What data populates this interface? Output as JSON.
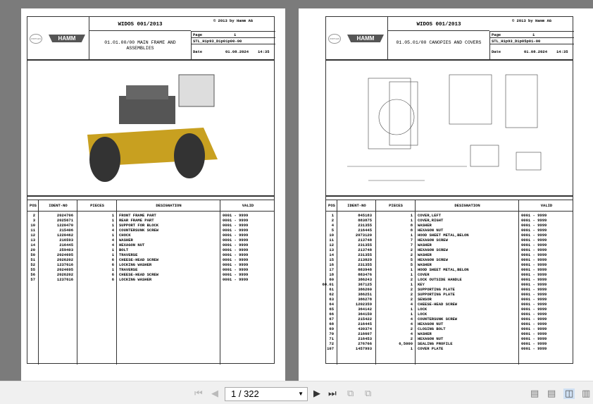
{
  "pages": [
    {
      "title": "WIDOS 001/2013",
      "copyright": "© 2013 by Hamm AG",
      "logo_brand": "HAMM",
      "logo_group": "WIRTGEN GROUP",
      "description": "01.01.00/00 MAIN FRAME AND ASSEMBLIES",
      "page_label": "Page",
      "page_no": "1",
      "doc_id": "STL_H1p93_D1p01p00-00",
      "date_label": "Date",
      "date": "01.08.2024",
      "time": "14:35",
      "figure_callouts": [
        "12",
        "10",
        "11",
        "13",
        "14",
        "11",
        "13",
        "14",
        "56",
        "20",
        "50",
        "51",
        "52",
        "55",
        "56",
        "57",
        "2",
        "3"
      ],
      "headers": {
        "pos": "POS",
        "ident": "IDENT-NO",
        "pieces": "PIECES",
        "designation": "DESIGNATION",
        "valid": "VALID"
      },
      "rows": [
        [
          "2",
          "2024706",
          "1",
          "FRONT FRAME PART",
          "0001 - 9999"
        ],
        [
          "3",
          "2025671",
          "1",
          "REAR FRAME PART",
          "0001 - 9999"
        ],
        [
          "10",
          "1220470",
          "1",
          "SUPPORT FOR BLOCK",
          "0001 - 9999"
        ],
        [
          "11",
          "215406",
          "4",
          "COUNTERSUNK SCREW",
          "0001 - 9999"
        ],
        [
          "12",
          "1220462",
          "1",
          "CHOCK",
          "0001 - 9999"
        ],
        [
          "13",
          "216593",
          "4",
          "WASHER",
          "0001 - 9999"
        ],
        [
          "14",
          "216445",
          "4",
          "HEXAGON NUT",
          "0001 - 9999"
        ],
        [
          "20",
          "259403",
          "1",
          "BOLT",
          "0001 - 9999"
        ],
        [
          "50",
          "2024695",
          "1",
          "TRAVERSE",
          "0001 - 9999"
        ],
        [
          "51",
          "2026202",
          "6",
          "CHEESE-HEAD SCREW",
          "0001 - 9999"
        ],
        [
          "52",
          "1237616",
          "6",
          "LOCKING WASHER",
          "0001 - 9999"
        ],
        [
          "55",
          "2024695",
          "1",
          "TRAVERSE",
          "0001 - 9999"
        ],
        [
          "56",
          "2026202",
          "6",
          "CHEESE-HEAD SCREW",
          "0001 - 9999"
        ],
        [
          "57",
          "1237616",
          "6",
          "LOCKING WASHER",
          "0001 - 9999"
        ]
      ]
    },
    {
      "title": "WIDOS 001/2013",
      "copyright": "© 2013 by Hamm AG",
      "logo_brand": "HAMM",
      "logo_group": "WIRTGEN GROUP",
      "description": "01.05.01/00 CANOPIES AND COVERS",
      "page_label": "Page",
      "page_no": "1",
      "doc_id": "STL_H1p93_D1p05p01-00",
      "date_label": "Date",
      "date": "01.08.2024",
      "time": "14:35",
      "figure_callouts": [
        "ANSICHT X",
        "ANSICHT Y",
        "ANSICHT Z",
        "EINZELHEIT X",
        "SCHNITT G-E",
        "EINZELHEIT Y"
      ],
      "headers": {
        "pos": "POS",
        "ident": "IDENT-NO",
        "pieces": "PIECES",
        "designation": "DESIGNATION",
        "valid": "VALID"
      },
      "rows": [
        [
          "1",
          "845183",
          "1",
          "COVER,LEFT",
          "0001 - 9999"
        ],
        [
          "2",
          "883875",
          "1",
          "COVER,RIGHT",
          "0001 - 9999"
        ],
        [
          "4",
          "231355",
          "8",
          "WASHER",
          "0001 - 9999"
        ],
        [
          "5",
          "216445",
          "8",
          "HEXAGON NUT",
          "0001 - 9999"
        ],
        [
          "10",
          "2073120",
          "1",
          "HOOD SHEET METAL,BELON",
          "0001 - 9999"
        ],
        [
          "11",
          "213748",
          "7",
          "HEXAGON SCREW",
          "0001 - 9999"
        ],
        [
          "12",
          "231355",
          "7",
          "WASHER",
          "0001 - 9999"
        ],
        [
          "13",
          "213748",
          "2",
          "HEXAGON SCREW",
          "0001 - 9999"
        ],
        [
          "14",
          "231355",
          "2",
          "WASHER",
          "0001 - 9999"
        ],
        [
          "15",
          "213829",
          "5",
          "HEXAGON SCREW",
          "0001 - 9999"
        ],
        [
          "16",
          "231355",
          "5",
          "WASHER",
          "0001 - 9999"
        ],
        [
          "17",
          "883948",
          "1",
          "HOOD SHEET METAL,BELON",
          "0001 - 9999"
        ],
        [
          "18",
          "883476",
          "1",
          "COVER",
          "0001 - 9999"
        ],
        [
          "60",
          "386243",
          "2",
          "LOCK OUTSIDE HANDLE",
          "0001 - 9999"
        ],
        [
          "60.01",
          "367125",
          "1",
          "KEY",
          "0001 - 9999"
        ],
        [
          "61",
          "386260",
          "2",
          "SUPPORTING PLATE",
          "0001 - 9999"
        ],
        [
          "62",
          "386251",
          "2",
          "SUPPORTING PLATE",
          "0001 - 9999"
        ],
        [
          "63",
          "386278",
          "2",
          "SENSOR",
          "0001 - 9999"
        ],
        [
          "64",
          "1202359",
          "4",
          "CHEESE-HEAD SCREW",
          "0001 - 9999"
        ],
        [
          "65",
          "364142",
          "1",
          "LOCK",
          "0001 - 9999"
        ],
        [
          "66",
          "364150",
          "1",
          "LOCK",
          "0001 - 9999"
        ],
        [
          "67",
          "215422",
          "4",
          "COUNTERSUNK SCREW",
          "0001 - 9999"
        ],
        [
          "68",
          "216445",
          "4",
          "HEXAGON NUT",
          "0001 - 9999"
        ],
        [
          "69",
          "430374",
          "2",
          "CLOSING BOLT",
          "0001 - 9999"
        ],
        [
          "70",
          "216607",
          "4",
          "WASHER",
          "0001 - 9999"
        ],
        [
          "71",
          "216453",
          "2",
          "HEXAGON NUT",
          "0001 - 9999"
        ],
        [
          "72",
          "276766",
          "6,5000",
          "SEALING PROFILE",
          "0001 - 9999"
        ],
        [
          "107",
          "1457993",
          "1",
          "COVER PLATE",
          "0001 - 9999"
        ]
      ]
    }
  ],
  "toolbar": {
    "page_indicator": "1 / 322",
    "icons": [
      "first-page",
      "prev-page",
      "next-page",
      "last-page",
      "rotate-ccw",
      "rotate-cw",
      "single-page",
      "continuous",
      "two-page",
      "two-page-continuous"
    ],
    "active_view": "two-page"
  }
}
